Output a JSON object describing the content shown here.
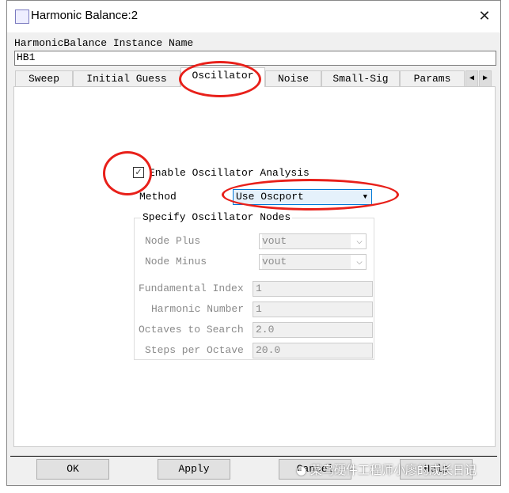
{
  "window": {
    "title": "Harmonic Balance:2",
    "icon": "harmonic-balance-icon",
    "close_icon": "close-icon"
  },
  "instance": {
    "label": "HarmonicBalance Instance Name",
    "value": "HB1"
  },
  "tabs": [
    {
      "label": "Sweep"
    },
    {
      "label": "Initial Guess"
    },
    {
      "label": "Oscillator",
      "active": true
    },
    {
      "label": "Noise"
    },
    {
      "label": "Small-Sig"
    },
    {
      "label": "Params"
    }
  ],
  "tab_scroll": {
    "left": "◀",
    "right": "▶"
  },
  "oscillator": {
    "enable_label": "Enable Oscillator Analysis",
    "enabled": true,
    "method_label": "Method",
    "method_value": "Use Oscport",
    "group_title": "Specify Oscillator Nodes",
    "node_plus_label": "Node Plus",
    "node_plus_value": "vout",
    "node_minus_label": "Node Minus",
    "node_minus_value": "vout",
    "fundamental_index_label": "Fundamental Index",
    "fundamental_index_value": "1",
    "harmonic_number_label": "Harmonic Number",
    "harmonic_number_value": "1",
    "octaves_label": "Octaves to Search",
    "octaves_value": "2.0",
    "steps_label": "Steps per Octave",
    "steps_value": "20.0"
  },
  "buttons": {
    "ok": "OK",
    "apply": "Apply",
    "cancel": "Cancel",
    "help": "Help"
  },
  "watermark": "菜鸟硬件工程师小廖的成长日记",
  "colors": {
    "annotation": "#e8201a",
    "accent": "#0078d7"
  }
}
